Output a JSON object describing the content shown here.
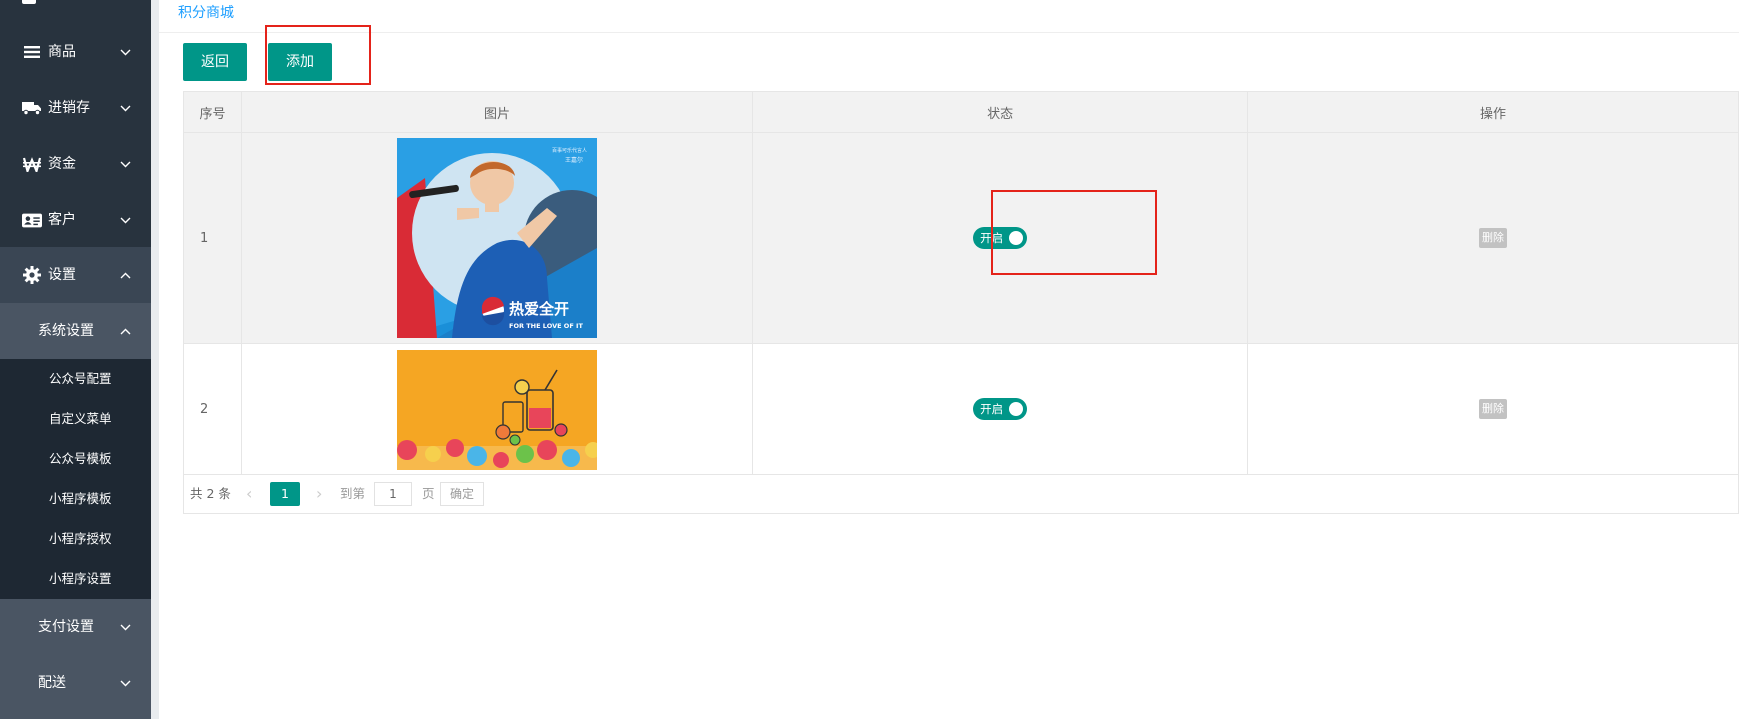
{
  "breadcrumb": "积分商城",
  "toolbar": {
    "back_label": "返回",
    "add_label": "添加"
  },
  "sidebar": {
    "top_items": [
      {
        "label": "商品",
        "icon": "list-icon"
      },
      {
        "label": "进销存",
        "icon": "truck-icon"
      },
      {
        "label": "资金",
        "icon": "won-icon"
      },
      {
        "label": "客户",
        "icon": "id-card-icon"
      },
      {
        "label": "设置",
        "icon": "gear-icon"
      }
    ],
    "submenu_title": "系统设置",
    "submenu_items": [
      "公众号配置",
      "自定义菜单",
      "公众号模板",
      "小程序模板",
      "小程序授权",
      "小程序设置"
    ],
    "bottom_items": [
      {
        "label": "支付设置"
      },
      {
        "label": "配送"
      }
    ]
  },
  "table": {
    "headers": [
      "序号",
      "图片",
      "状态",
      "操作"
    ],
    "rows": [
      {
        "index": "1",
        "status": "开启",
        "action": "删除",
        "enabled": true,
        "image": {
          "headline": "热爱全开",
          "tagline": "FOR THE LOVE OF IT",
          "small_text": "百事可乐代言人",
          "name_text": "王嘉尔"
        }
      },
      {
        "index": "2",
        "status": "开启",
        "action": "删除",
        "enabled": true
      }
    ]
  },
  "pager": {
    "total": "共 2 条",
    "current": "1",
    "goto_label": "到第",
    "input_value": "1",
    "unit_label": "页",
    "confirm_label": "确定"
  },
  "colors": {
    "accent": "#009688",
    "sidebar": "#28333e",
    "link": "#1e9fff",
    "highlight": "#e4231a"
  }
}
